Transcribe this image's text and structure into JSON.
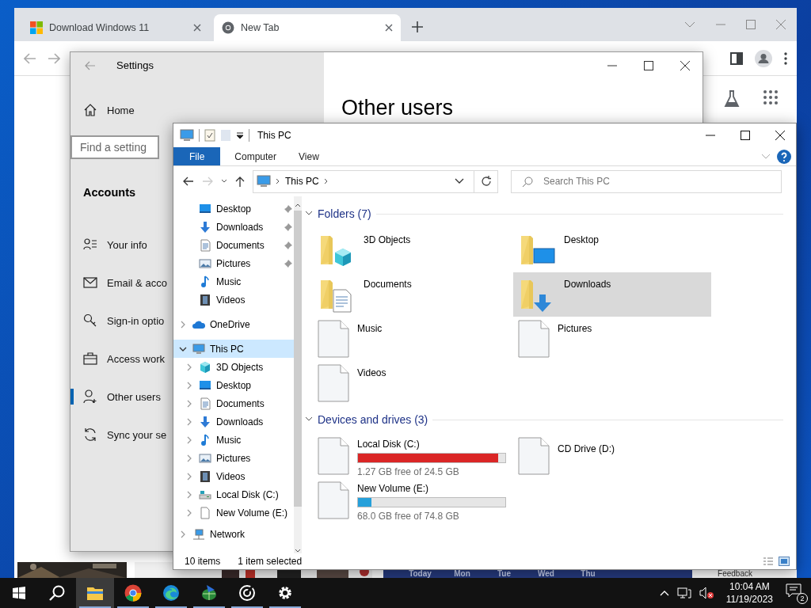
{
  "browser": {
    "tabs": [
      {
        "title": "Download Windows 11",
        "kind": "windows",
        "selected": false
      },
      {
        "title": "New Tab",
        "kind": "chrome",
        "selected": true
      }
    ],
    "page_strip": {
      "days": [
        "Today",
        "Mon",
        "Tue",
        "Wed",
        "Thu"
      ],
      "link": "Feedback"
    }
  },
  "settings": {
    "title": "Settings",
    "home": "Home",
    "search": {
      "placeholder": "Find a setting"
    },
    "section": "Accounts",
    "items": [
      {
        "label": "Your info",
        "kind": "info",
        "selected": false
      },
      {
        "label": "Email & acco",
        "kind": "email",
        "selected": false
      },
      {
        "label": "Sign-in optio",
        "kind": "key",
        "selected": false
      },
      {
        "label": "Access work",
        "kind": "briefcase",
        "selected": false
      },
      {
        "label": "Other users",
        "kind": "person",
        "selected": true
      },
      {
        "label": "Sync your se",
        "kind": "sync",
        "selected": false
      }
    ],
    "heading": "Other users"
  },
  "explorer": {
    "title": "This PC",
    "ribbon_tabs": [
      {
        "label": "File",
        "selected": true
      },
      {
        "label": "Computer",
        "selected": false
      },
      {
        "label": "View",
        "selected": false
      }
    ],
    "address": "This PC",
    "search": {
      "placeholder": "Search This PC"
    },
    "nav": {
      "quick_access": [
        {
          "label": "Desktop",
          "kind": "desktop",
          "pinned": true,
          "selected": false
        },
        {
          "label": "Downloads",
          "kind": "downloads",
          "pinned": true,
          "selected": false
        },
        {
          "label": "Documents",
          "kind": "documents",
          "pinned": true,
          "selected": false
        },
        {
          "label": "Pictures",
          "kind": "pictures",
          "pinned": true,
          "selected": false
        },
        {
          "label": "Music",
          "kind": "music",
          "pinned": false,
          "selected": false
        },
        {
          "label": "Videos",
          "kind": "videos",
          "pinned": false,
          "selected": false
        }
      ],
      "tree": [
        {
          "label": "OneDrive",
          "kind": "onedrive",
          "expanded": false,
          "selected": false
        },
        {
          "label": "This PC",
          "kind": "pc",
          "expanded": true,
          "selected": true,
          "children": [
            {
              "label": "3D Objects",
              "kind": "objects3d",
              "expanded": false,
              "selected": false
            },
            {
              "label": "Desktop",
              "kind": "desktop",
              "expanded": false,
              "selected": false
            },
            {
              "label": "Documents",
              "kind": "documents",
              "expanded": false,
              "selected": false
            },
            {
              "label": "Downloads",
              "kind": "downloads",
              "expanded": false,
              "selected": false
            },
            {
              "label": "Music",
              "kind": "music",
              "expanded": false,
              "selected": false
            },
            {
              "label": "Pictures",
              "kind": "pictures",
              "expanded": false,
              "selected": false
            },
            {
              "label": "Videos",
              "kind": "videos",
              "expanded": false,
              "selected": false
            },
            {
              "label": "Local Disk (C:)",
              "kind": "drive",
              "expanded": false,
              "selected": false
            },
            {
              "label": "New Volume (E:)",
              "kind": "file",
              "expanded": false,
              "selected": false
            }
          ]
        },
        {
          "label": "Network",
          "kind": "network",
          "expanded": false,
          "selected": false
        }
      ]
    },
    "groups": [
      {
        "title": "Folders (7)",
        "expanded": true,
        "items": [
          {
            "name": "3D Objects",
            "kind": "objects3d",
            "selected": false
          },
          {
            "name": "Desktop",
            "kind": "desktop",
            "selected": false
          },
          {
            "name": "Documents",
            "kind": "documents",
            "selected": false
          },
          {
            "name": "Downloads",
            "kind": "downloads",
            "selected": true
          },
          {
            "name": "Music",
            "kind": "file",
            "selected": false
          },
          {
            "name": "Pictures",
            "kind": "file",
            "selected": false
          },
          {
            "name": "Videos",
            "kind": "file",
            "selected": false
          }
        ]
      },
      {
        "title": "Devices and drives (3)",
        "expanded": true,
        "items": [
          {
            "name": "Local Disk (C:)",
            "kind": "drive",
            "level": 0.95,
            "free": "1.27 GB free of 24.5 GB",
            "selected": false
          },
          {
            "name": "CD Drive (D:)",
            "kind": "cd",
            "selected": false
          },
          {
            "name": "New Volume (E:)",
            "kind": "drive",
            "level": 0.09,
            "free": "68.0 GB free of 74.8 GB",
            "selected": false
          }
        ]
      }
    ],
    "status": {
      "count": "10 items",
      "selection": "1 item selected"
    }
  },
  "taskbar": {
    "apps": [
      {
        "kind": "explorer",
        "running": true,
        "active": true
      },
      {
        "kind": "chrome",
        "running": true,
        "active": false
      },
      {
        "kind": "edge",
        "running": true,
        "active": false
      },
      {
        "kind": "globe",
        "running": true,
        "active": false
      },
      {
        "kind": "target",
        "running": true,
        "active": false
      },
      {
        "kind": "gear",
        "running": true,
        "active": false
      }
    ],
    "tray": {
      "muted": true,
      "time": "10:04 AM",
      "date": "11/19/2023",
      "notifications": "2"
    }
  }
}
